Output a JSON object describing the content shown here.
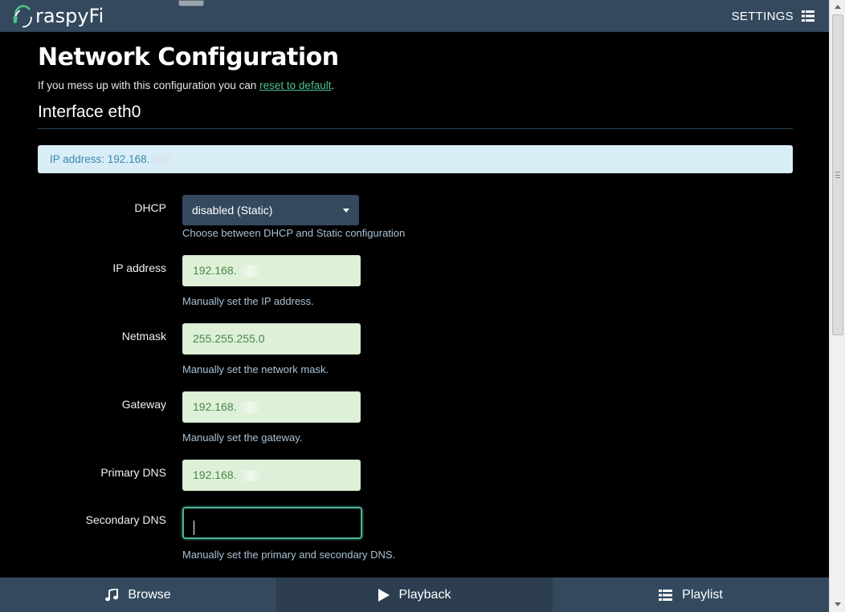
{
  "header": {
    "logo_text": "raspyFi",
    "settings_label": "SETTINGS"
  },
  "page": {
    "title": "Network Configuration",
    "intro_text": "If you mess up with this configuration you can ",
    "intro_link": "reset to default",
    "intro_end": ".",
    "interface_title": "Interface eth0",
    "alert_text": "IP address: 192.168."
  },
  "form": {
    "dhcp": {
      "label": "DHCP",
      "value": "disabled (Static)",
      "help": "Choose between DHCP and Static configuration"
    },
    "ip": {
      "label": "IP address",
      "value": "192.168.",
      "help": "Manually set the IP address."
    },
    "netmask": {
      "label": "Netmask",
      "value": "255.255.255.0",
      "help": "Manually set the network mask."
    },
    "gateway": {
      "label": "Gateway",
      "value": "192.168.",
      "help": "Manually set the gateway."
    },
    "dns1": {
      "label": "Primary DNS",
      "value": "192.168."
    },
    "dns2": {
      "label": "Secondary DNS",
      "value": "",
      "help": "Manually set the primary and secondary DNS."
    }
  },
  "footer": {
    "browse_label": "Browse",
    "playback_label": "Playback",
    "playlist_label": "Playlist"
  },
  "colors": {
    "bar": "#34495e",
    "accent_green": "#4fc08d",
    "input_success_bg": "#dff0d8",
    "input_success_text": "#468847",
    "alert_bg": "#d9edf7"
  },
  "icons": [
    "headphone-logo-icon",
    "list-icon",
    "music-note-icon",
    "play-icon",
    "playlist-icon"
  ]
}
